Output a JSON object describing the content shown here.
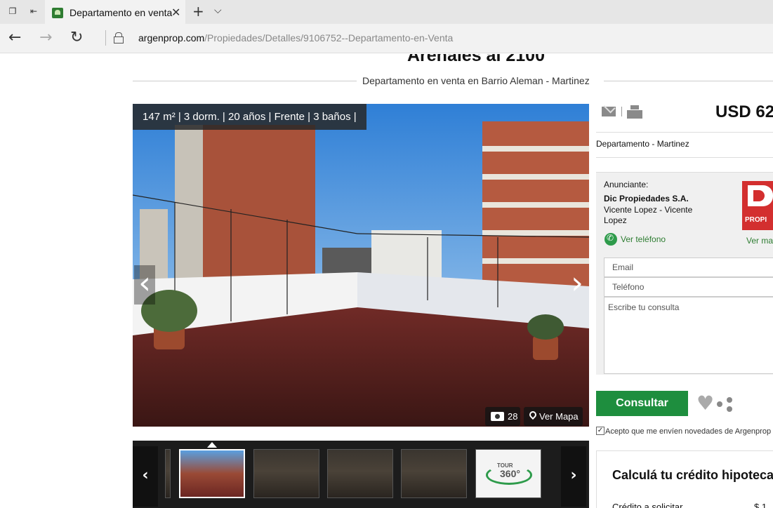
{
  "browser": {
    "tab_title": "Departamento en venta",
    "url_host": "argenprop.com",
    "url_path": "/Propiedades/Detalles/9106752--Departamento-en-Venta"
  },
  "listing": {
    "title": "Arenales al 2100",
    "subtitle": "Departamento en venta en Barrio Aleman - Martinez",
    "features": "147 m²  |  3 dorm.  |  20 años  |  Frente  |  3 baños |",
    "photo_count": "28",
    "map_label": "Ver Mapa",
    "tour_label": "TOUR",
    "tour_360": "360°"
  },
  "sidebar": {
    "price": "USD 62",
    "property_type": "Departamento - Martinez",
    "advertiser_label": "Anunciante:",
    "advertiser_name": "Dic Propiedades S.A.",
    "advertiser_location": "Vicente Lopez - Vicente Lopez",
    "phone_label": "Ver teléfono",
    "logo_text": "PROPI",
    "more_label": "Ver ma",
    "email_placeholder": "Email",
    "phone_placeholder": "Teléfono",
    "message_placeholder": "Escribe tu consulta",
    "consult_button": "Consultar",
    "newsletter_label": "Acepto que me envíen novedades de Argenprop",
    "calc_title": "Calculá tu crédito hipoteca",
    "calc_label": "Crédito a solicitar",
    "calc_value": "$ 1"
  }
}
